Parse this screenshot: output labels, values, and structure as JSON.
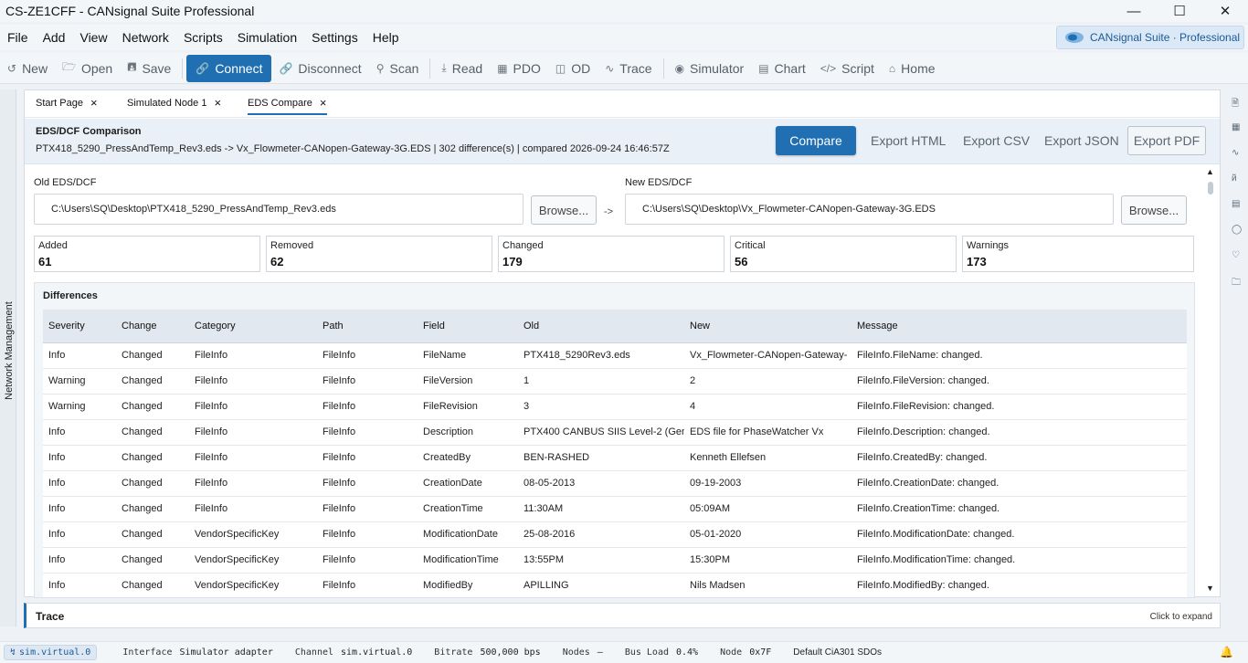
{
  "window": {
    "title": "CS-ZE1CFF - CANsignal Suite Professional"
  },
  "menu": [
    "File",
    "Add",
    "View",
    "Network",
    "Scripts",
    "Simulation",
    "Settings",
    "Help"
  ],
  "brand": {
    "label": "CANsignal Suite · Professional"
  },
  "toolbar": {
    "new": "New",
    "open": "Open",
    "save": "Save",
    "connect": "Connect",
    "disconnect": "Disconnect",
    "scan": "Scan",
    "read": "Read",
    "pdo": "PDO",
    "od": "OD",
    "trace": "Trace",
    "simulator": "Simulator",
    "chart": "Chart",
    "script": "Script",
    "home": "Home"
  },
  "left_panel": {
    "label": "Network Management"
  },
  "tabs": [
    {
      "label": "Start Page"
    },
    {
      "label": "Simulated Node 1"
    },
    {
      "label": "EDS Compare"
    }
  ],
  "compare": {
    "title": "EDS/DCF Comparison",
    "summary": "PTX418_5290_PressAndTemp_Rev3.eds -> Vx_Flowmeter-CANopen-Gateway-3G.EDS | 302 difference(s) | compared 2026-09-24 16:46:57Z",
    "compare_label": "Compare",
    "export_html": "Export HTML",
    "export_csv": "Export CSV",
    "export_json": "Export JSON",
    "export_pdf": "Export PDF",
    "old_label": "Old EDS/DCF",
    "old_path": "C:\\Users\\SQ\\Desktop\\PTX418_5290_PressAndTemp_Rev3.eds",
    "new_label": "New EDS/DCF",
    "new_path": "C:\\Users\\SQ\\Desktop\\Vx_Flowmeter-CANopen-Gateway-3G.EDS",
    "browse": "Browse...",
    "arrow": "->"
  },
  "stats": [
    {
      "label": "Added",
      "value": "61"
    },
    {
      "label": "Removed",
      "value": "62"
    },
    {
      "label": "Changed",
      "value": "179"
    },
    {
      "label": "Critical",
      "value": "56"
    },
    {
      "label": "Warnings",
      "value": "173"
    }
  ],
  "differences": {
    "title": "Differences",
    "columns": [
      "Severity",
      "Change",
      "Category",
      "Path",
      "Field",
      "Old",
      "New",
      "Message"
    ],
    "rows": [
      [
        "Info",
        "Changed",
        "FileInfo",
        "FileInfo",
        "FileName",
        "PTX418_5290Rev3.eds",
        "Vx_Flowmeter-CANopen-Gateway-",
        "FileInfo.FileName: changed."
      ],
      [
        "Warning",
        "Changed",
        "FileInfo",
        "FileInfo",
        "FileVersion",
        "1",
        "2",
        "FileInfo.FileVersion: changed."
      ],
      [
        "Warning",
        "Changed",
        "FileInfo",
        "FileInfo",
        "FileRevision",
        "3",
        "4",
        "FileInfo.FileRevision: changed."
      ],
      [
        "Info",
        "Changed",
        "FileInfo",
        "FileInfo",
        "Description",
        "PTX400 CANBUS SIIS Level-2 (Gene",
        "EDS file for PhaseWatcher Vx",
        "FileInfo.Description: changed."
      ],
      [
        "Info",
        "Changed",
        "FileInfo",
        "FileInfo",
        "CreatedBy",
        "BEN-RASHED",
        "Kenneth Ellefsen",
        "FileInfo.CreatedBy: changed."
      ],
      [
        "Info",
        "Changed",
        "FileInfo",
        "FileInfo",
        "CreationDate",
        "08-05-2013",
        "09-19-2003",
        "FileInfo.CreationDate: changed."
      ],
      [
        "Info",
        "Changed",
        "FileInfo",
        "FileInfo",
        "CreationTime",
        "11:30AM",
        "05:09AM",
        "FileInfo.CreationTime: changed."
      ],
      [
        "Info",
        "Changed",
        "VendorSpecificKey",
        "FileInfo",
        "ModificationDate",
        "25-08-2016",
        "05-01-2020",
        "FileInfo.ModificationDate: changed."
      ],
      [
        "Info",
        "Changed",
        "VendorSpecificKey",
        "FileInfo",
        "ModificationTime",
        "13:55PM",
        "15:30PM",
        "FileInfo.ModificationTime: changed."
      ],
      [
        "Info",
        "Changed",
        "VendorSpecificKey",
        "FileInfo",
        "ModifiedBy",
        "APILLING",
        "Nils Madsen",
        "FileInfo.ModifiedBy: changed."
      ]
    ]
  },
  "trace_panel": {
    "title": "Trace",
    "expand": "Click to expand"
  },
  "status": {
    "chip": "sim.virtual.0",
    "interface_key": "Interface",
    "interface_val": "Simulator adapter",
    "channel_key": "Channel",
    "channel_val": "sim.virtual.0",
    "bitrate_key": "Bitrate",
    "bitrate_val": "500,000 bps",
    "nodes_key": "Nodes",
    "nodes_val": "–",
    "busload_key": "Bus Load",
    "busload_val": "0.4%",
    "node_key": "Node",
    "node_val": "0x7F",
    "sdo": "Default CiA301 SDOs"
  },
  "colors": {
    "accent": "#1f6fb2",
    "header_bg": "#e9f0f7",
    "grid_header": "#e2e8ef"
  }
}
